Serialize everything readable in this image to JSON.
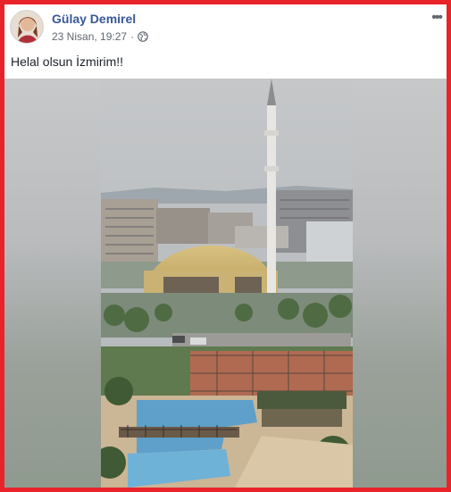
{
  "post": {
    "author": "Gülay Demirel",
    "date": "23 Nisan, 19:27",
    "separator": "·",
    "text": "Helal olsun İzmirim!!",
    "more_icon": "ellipsis-icon",
    "privacy_icon": "globe-icon"
  },
  "colors": {
    "frame": "#e8242a",
    "author": "#385898",
    "meta": "#616770"
  }
}
